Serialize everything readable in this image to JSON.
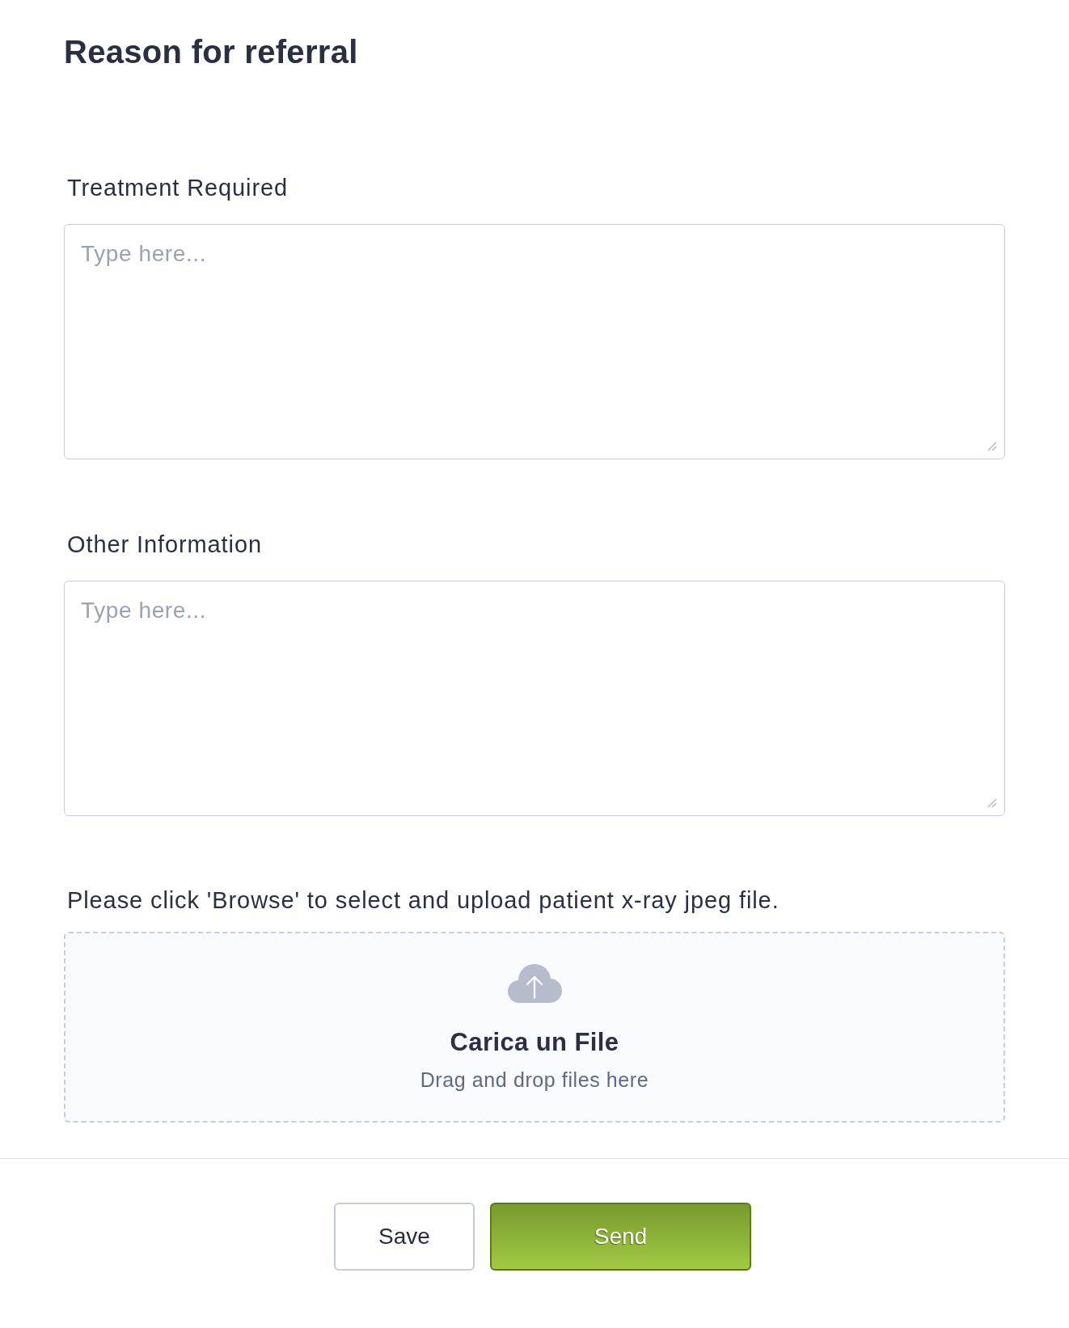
{
  "title": "Reason for referral",
  "fields": [
    {
      "label": "Treatment Required",
      "placeholder": "Type here..."
    },
    {
      "label": "Other Information",
      "placeholder": "Type here..."
    }
  ],
  "upload": {
    "instructions": "Please click 'Browse' to select and upload patient x-ray jpeg file.",
    "title": "Carica un File",
    "hint": "Drag and drop files here"
  },
  "buttons": [
    {
      "label": "Save",
      "kind": "secondary"
    },
    {
      "label": "Send",
      "kind": "primary"
    }
  ]
}
